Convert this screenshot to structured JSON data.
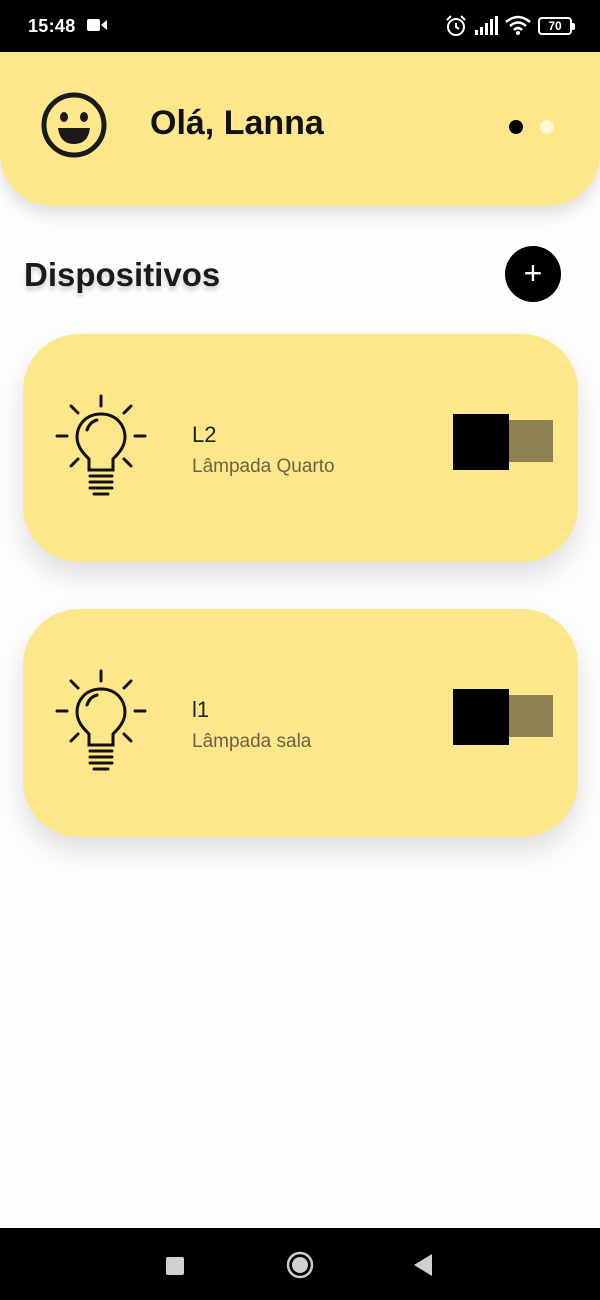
{
  "status_bar": {
    "time": "15:48",
    "battery": "70",
    "icons": [
      "video-camera-icon",
      "alarm-icon",
      "signal-icon",
      "wifi-icon",
      "battery-icon"
    ]
  },
  "header": {
    "greeting": "Olá, Lanna",
    "avatar_icon": "smiley-face-icon",
    "page_indicator": {
      "count": 2,
      "active": 0
    },
    "background_color": "#fde78a"
  },
  "devices_section": {
    "title": "Dispositivos",
    "add_icon": "plus-icon",
    "add_label": "+"
  },
  "devices": [
    {
      "name": "L2",
      "description": "Lâmpada Quarto",
      "icon": "light-bulb-icon",
      "switch_on": false
    },
    {
      "name": "l1",
      "description": "Lâmpada sala",
      "icon": "light-bulb-icon",
      "switch_on": false
    }
  ],
  "nav_bar": {
    "icons": [
      "recent-apps-icon",
      "home-icon",
      "back-icon"
    ]
  },
  "colors": {
    "accent": "#fde78a",
    "switch_track": "#8e8152",
    "switch_thumb": "#000000"
  }
}
